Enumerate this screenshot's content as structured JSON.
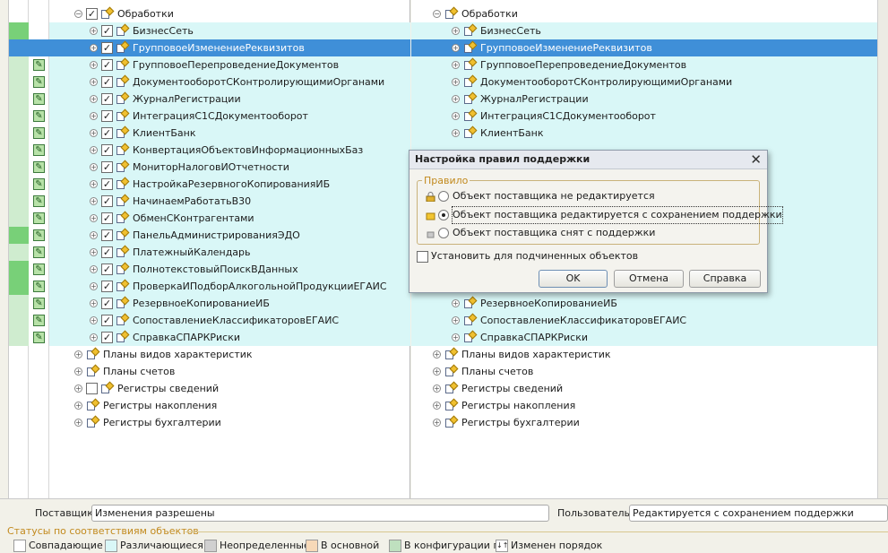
{
  "colors": {
    "different_bg": "#d9f7f7",
    "selected_bg": "#3f8fd8",
    "green_mark": "#78d078",
    "status_title": "#c28a1e"
  },
  "left_tree": {
    "top_partial": "",
    "processing_folder": "Обработки",
    "items": [
      "БизнесСеть",
      "ГрупповоеИзменениеРеквизитов",
      "ГрупповоеПерепроведениеДокументов",
      "ДокументооборотСКонтролирующимиОрганами",
      "ЖурналРегистрации",
      "ИнтеграцияС1СДокументооборот",
      "КлиентБанк",
      "КонвертацияОбъектовИнформационныхБаз",
      "МониторНалоговИОтчетности",
      "НастройкаРезервногоКопированияИБ",
      "НачинаемРаботатьВ30",
      "ОбменСКонтрагентами",
      "ПанельАдминистрированияЭДО",
      "ПлатежныйКалендарь",
      "ПолнотекстовыйПоискВДанных",
      "ПроверкаИПодборАлкогольнойПродукцииЕГАИС",
      "РезервноеКопированиеИБ",
      "СопоставлениеКлассификаторовЕГАИС",
      "СправкаСПАРКРиски"
    ],
    "groups": [
      "Планы видов характеристик",
      "Планы счетов",
      "Регистры сведений",
      "Регистры накопления",
      "Регистры бухгалтерии"
    ]
  },
  "right_tree": {
    "processing_folder": "Обработки",
    "items_top": [
      "БизнесСеть",
      "ГрупповоеИзменениеРеквизитов",
      "ГрупповоеПерепроведениеДокументов",
      "ДокументооборотСКонтролирующимиОрганами",
      "ЖурналРегистрации",
      "ИнтеграцияС1СДокументооборот",
      "КлиентБанк"
    ],
    "items_bottom": [
      "РезервноеКопированиеИБ",
      "СопоставлениеКлассификаторовЕГАИС",
      "СправкаСПАРКРиски"
    ],
    "groups": [
      "Планы видов характеристик",
      "Планы счетов",
      "Регистры сведений",
      "Регистры накопления",
      "Регистры бухгалтерии"
    ]
  },
  "dialog": {
    "title": "Настройка правил поддержки",
    "group_title": "Правило",
    "options": [
      "Объект поставщика не редактируется",
      "Объект поставщика редактируется с сохранением поддержки",
      "Объект поставщика снят с поддержки"
    ],
    "selected_index": 1,
    "checkbox_label": "Установить для подчиненных объектов",
    "ok": "OK",
    "cancel": "Отмена",
    "help": "Справка"
  },
  "bottom": {
    "supplier_label": "Поставщик:",
    "supplier_value": "Изменения разрешены",
    "user_label": "Пользователь:",
    "user_value": "Редактируется с сохранением поддержки",
    "status_title": "Статусы по соответствиям объектов",
    "legend": [
      {
        "label": "Совпадающие",
        "color": "#ffffff"
      },
      {
        "label": "Различающиеся",
        "color": "#d9f7f7"
      },
      {
        "label": "Неопределенные",
        "color": "#d0d0d0"
      },
      {
        "label": "В основной",
        "color": "#f7d9b8"
      },
      {
        "label": "В конфигурации п...",
        "color": "#bfe0bf"
      },
      {
        "label": "Изменен порядок",
        "color": "#ffffff"
      }
    ]
  }
}
